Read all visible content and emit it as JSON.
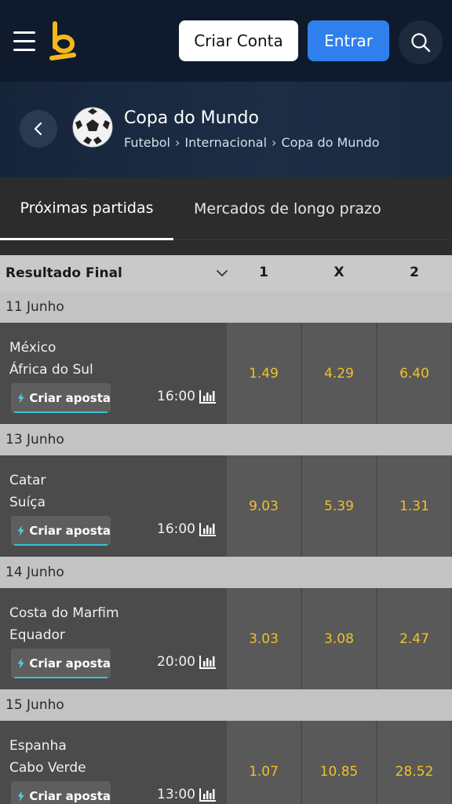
{
  "header": {
    "create_account": "Criar Conta",
    "login": "Entrar"
  },
  "competition": {
    "title": "Copa do Mundo",
    "breadcrumb": [
      "Futebol",
      "Internacional",
      "Copa do Mundo"
    ]
  },
  "tabs": [
    {
      "label": "Próximas partidas",
      "active": true
    },
    {
      "label": "Mercados de longo prazo",
      "active": false
    }
  ],
  "market": {
    "label": "Resultado Final",
    "columns": [
      "1",
      "X",
      "2"
    ]
  },
  "groups": [
    {
      "date": "11 Junho",
      "matches": [
        {
          "home": "México",
          "away": "África do Sul",
          "time": "16:00",
          "odds": [
            "1.49",
            "4.29",
            "6.40"
          ],
          "bet_label": "Criar aposta"
        }
      ]
    },
    {
      "date": "13 Junho",
      "matches": [
        {
          "home": "Catar",
          "away": "Suíça",
          "time": "16:00",
          "odds": [
            "9.03",
            "5.39",
            "1.31"
          ],
          "bet_label": "Criar aposta"
        }
      ]
    },
    {
      "date": "14 Junho",
      "matches": [
        {
          "home": "Costa do Marfim",
          "away": "Equador",
          "time": "20:00",
          "odds": [
            "3.03",
            "3.08",
            "2.47"
          ],
          "bet_label": "Criar aposta"
        }
      ]
    },
    {
      "date": "15 Junho",
      "matches": [
        {
          "home": "Espanha",
          "away": "Cabo Verde",
          "time": "13:00",
          "odds": [
            "1.07",
            "10.85",
            "28.52"
          ],
          "bet_label": "Criar aposta"
        }
      ]
    }
  ],
  "colors": {
    "topbar": "#0f1b2d",
    "accent_blue": "#2f80ed",
    "odds_text": "#f0c02a",
    "bet_underline": "#37c4d8"
  },
  "icons": [
    "menu-icon",
    "brand-logo",
    "search-icon",
    "chevron-left-icon",
    "soccer-ball-icon",
    "chevron-right-icon",
    "chevron-down-icon",
    "lightning-icon",
    "stats-icon"
  ]
}
